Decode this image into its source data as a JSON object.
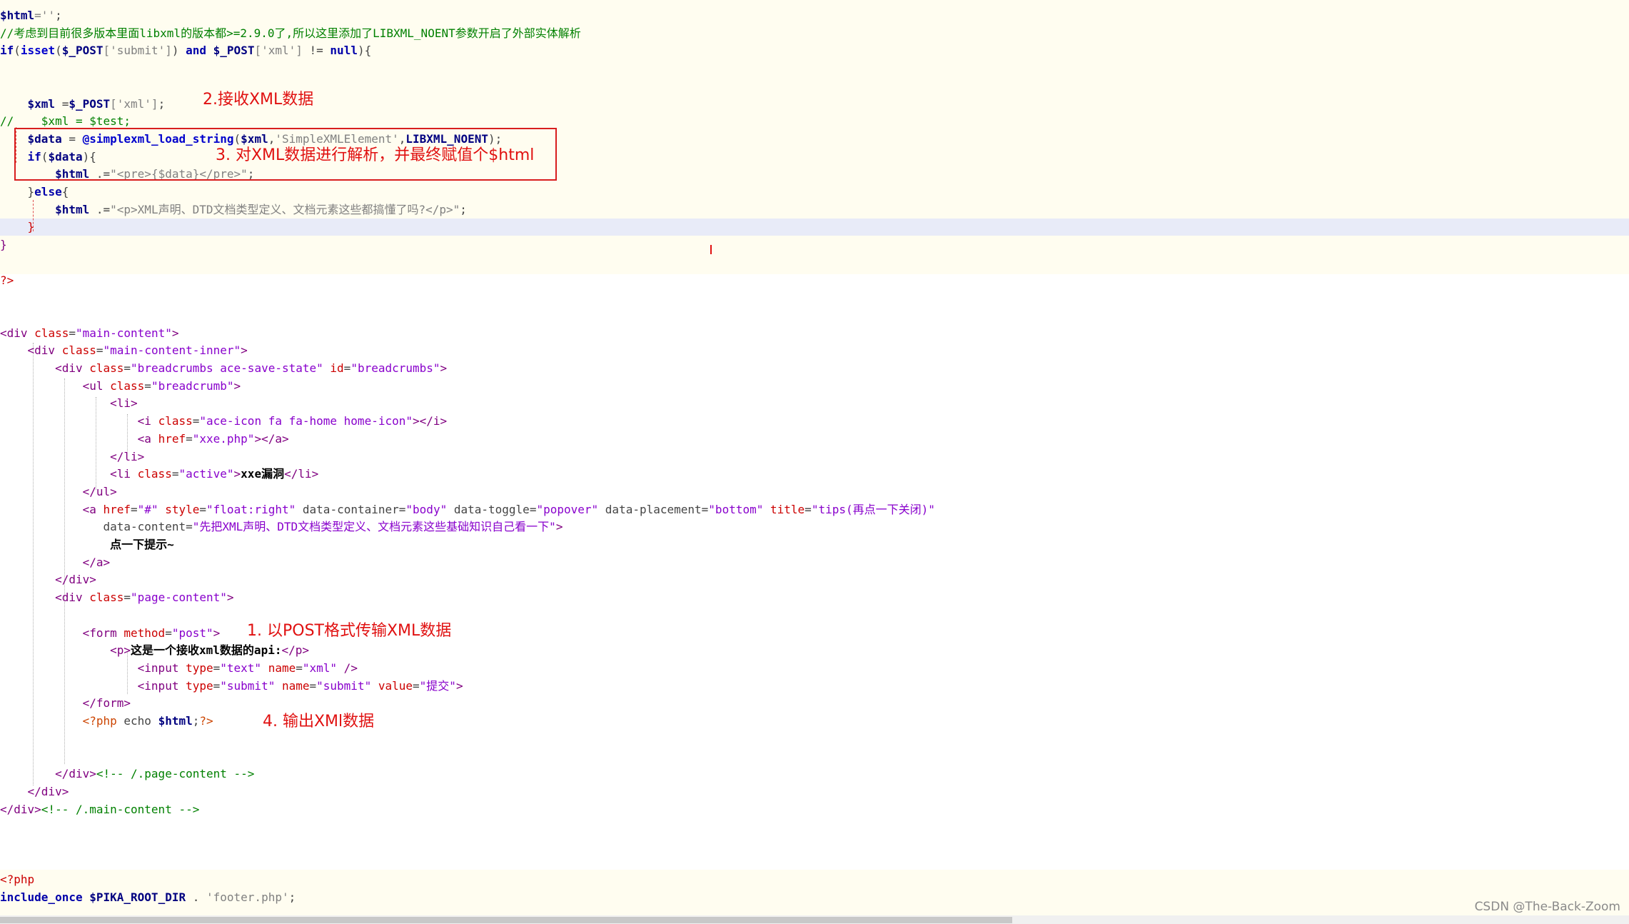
{
  "code": {
    "lines": [
      [
        {
          "t": "$html",
          "c": "v"
        },
        {
          "t": "=''",
          "c": "s"
        },
        {
          "t": ";",
          "c": "d"
        }
      ],
      [
        {
          "t": "//考虑到目前很多版本里面libxml的版本都>=2.9.0了,所以这里添加了LIBXML_NOENT参数开启了外部实体解析",
          "c": "c"
        }
      ],
      [
        {
          "t": "if",
          "c": "k"
        },
        {
          "t": "(",
          "c": "d"
        },
        {
          "t": "isset",
          "c": "f"
        },
        {
          "t": "(",
          "c": "d"
        },
        {
          "t": "$_POST",
          "c": "v"
        },
        {
          "t": "['submit']",
          "c": "s"
        },
        {
          "t": ") ",
          "c": "d"
        },
        {
          "t": "and",
          "c": "k"
        },
        {
          "t": " ",
          "c": "d"
        },
        {
          "t": "$_POST",
          "c": "v"
        },
        {
          "t": "['xml']",
          "c": "s"
        },
        {
          "t": " != ",
          "c": "d"
        },
        {
          "t": "null",
          "c": "k"
        },
        {
          "t": "){",
          "c": "d"
        }
      ],
      [],
      [],
      [
        {
          "t": "    ",
          "c": "d"
        },
        {
          "t": "$xml",
          "c": "v"
        },
        {
          "t": " =",
          "c": "d"
        },
        {
          "t": "$_POST",
          "c": "v"
        },
        {
          "t": "['xml']",
          "c": "s"
        },
        {
          "t": ";",
          "c": "d"
        }
      ],
      [
        {
          "t": "//    $xml = $test;",
          "c": "c"
        }
      ],
      [
        {
          "t": "    ",
          "c": "d"
        },
        {
          "t": "$data",
          "c": "v"
        },
        {
          "t": " = ",
          "c": "d"
        },
        {
          "t": "@simplexml_load_string",
          "c": "f"
        },
        {
          "t": "(",
          "c": "d"
        },
        {
          "t": "$xml",
          "c": "v"
        },
        {
          "t": ",",
          "c": "d"
        },
        {
          "t": "'SimpleXMLElement'",
          "c": "s"
        },
        {
          "t": ",",
          "c": "d"
        },
        {
          "t": "LIBXML_NOENT",
          "c": "v"
        },
        {
          "t": ");",
          "c": "d"
        }
      ],
      [
        {
          "t": "    ",
          "c": "d"
        },
        {
          "t": "if",
          "c": "k"
        },
        {
          "t": "(",
          "c": "d"
        },
        {
          "t": "$data",
          "c": "v"
        },
        {
          "t": "){",
          "c": "d"
        }
      ],
      [
        {
          "t": "        ",
          "c": "d"
        },
        {
          "t": "$html",
          "c": "v"
        },
        {
          "t": " .=",
          "c": "d"
        },
        {
          "t": "\"<pre>{$data}</pre>\"",
          "c": "s"
        },
        {
          "t": ";",
          "c": "d"
        }
      ],
      [
        {
          "t": "    }",
          "c": "d"
        },
        {
          "t": "else",
          "c": "k"
        },
        {
          "t": "{",
          "c": "d"
        }
      ],
      [
        {
          "t": "        ",
          "c": "d"
        },
        {
          "t": "$html",
          "c": "v"
        },
        {
          "t": " .=",
          "c": "d"
        },
        {
          "t": "\"<p>XML声明、DTD文档类型定义、文档元素这些都搞懂了吗?</p>\"",
          "c": "s"
        },
        {
          "t": ";",
          "c": "d"
        }
      ],
      [
        {
          "t": "    }",
          "c": "a"
        }
      ],
      [
        {
          "t": "}",
          "c": "t"
        }
      ],
      [],
      [
        {
          "t": "?>",
          "c": "a"
        }
      ],
      [],
      [],
      [
        {
          "t": "<div ",
          "c": "t"
        },
        {
          "t": "class",
          "c": "a"
        },
        {
          "t": "=",
          "c": "d"
        },
        {
          "t": "\"main-content\"",
          "c": "av"
        },
        {
          "t": ">",
          "c": "t"
        }
      ],
      [
        {
          "t": "    ",
          "c": "d"
        },
        {
          "t": "<div ",
          "c": "t"
        },
        {
          "t": "class",
          "c": "a"
        },
        {
          "t": "=",
          "c": "d"
        },
        {
          "t": "\"main-content-inner\"",
          "c": "av"
        },
        {
          "t": ">",
          "c": "t"
        }
      ],
      [
        {
          "t": "        ",
          "c": "d"
        },
        {
          "t": "<div ",
          "c": "t"
        },
        {
          "t": "class",
          "c": "a"
        },
        {
          "t": "=",
          "c": "d"
        },
        {
          "t": "\"breadcrumbs ace-save-state\"",
          "c": "av"
        },
        {
          "t": " ",
          "c": "d"
        },
        {
          "t": "id",
          "c": "a"
        },
        {
          "t": "=",
          "c": "d"
        },
        {
          "t": "\"breadcrumbs\"",
          "c": "av"
        },
        {
          "t": ">",
          "c": "t"
        }
      ],
      [
        {
          "t": "            ",
          "c": "d"
        },
        {
          "t": "<ul ",
          "c": "t"
        },
        {
          "t": "class",
          "c": "a"
        },
        {
          "t": "=",
          "c": "d"
        },
        {
          "t": "\"breadcrumb\"",
          "c": "av"
        },
        {
          "t": ">",
          "c": "t"
        }
      ],
      [
        {
          "t": "                ",
          "c": "d"
        },
        {
          "t": "<li>",
          "c": "t"
        }
      ],
      [
        {
          "t": "                    ",
          "c": "d"
        },
        {
          "t": "<i ",
          "c": "t"
        },
        {
          "t": "class",
          "c": "a"
        },
        {
          "t": "=",
          "c": "d"
        },
        {
          "t": "\"ace-icon fa fa-home home-icon\"",
          "c": "av"
        },
        {
          "t": "></i>",
          "c": "t"
        }
      ],
      [
        {
          "t": "                    ",
          "c": "d"
        },
        {
          "t": "<a ",
          "c": "t"
        },
        {
          "t": "href",
          "c": "a"
        },
        {
          "t": "=",
          "c": "d"
        },
        {
          "t": "\"xxe.php\"",
          "c": "av"
        },
        {
          "t": "></a>",
          "c": "t"
        }
      ],
      [
        {
          "t": "                ",
          "c": "d"
        },
        {
          "t": "</li>",
          "c": "t"
        }
      ],
      [
        {
          "t": "                ",
          "c": "d"
        },
        {
          "t": "<li ",
          "c": "t"
        },
        {
          "t": "class",
          "c": "a"
        },
        {
          "t": "=",
          "c": "d"
        },
        {
          "t": "\"active\"",
          "c": "av"
        },
        {
          "t": ">",
          "c": "t"
        },
        {
          "t": "xxe漏洞",
          "c": "b"
        },
        {
          "t": "</li>",
          "c": "t"
        }
      ],
      [
        {
          "t": "            ",
          "c": "d"
        },
        {
          "t": "</ul>",
          "c": "t"
        }
      ],
      [
        {
          "t": "            ",
          "c": "d"
        },
        {
          "t": "<a ",
          "c": "t"
        },
        {
          "t": "href",
          "c": "a"
        },
        {
          "t": "=",
          "c": "d"
        },
        {
          "t": "\"#\"",
          "c": "av"
        },
        {
          "t": " ",
          "c": "d"
        },
        {
          "t": "style",
          "c": "a"
        },
        {
          "t": "=",
          "c": "d"
        },
        {
          "t": "\"float:right\"",
          "c": "av"
        },
        {
          "t": " ",
          "c": "d"
        },
        {
          "t": "data-container",
          "c": "d"
        },
        {
          "t": "=",
          "c": "d"
        },
        {
          "t": "\"body\"",
          "c": "av"
        },
        {
          "t": " ",
          "c": "d"
        },
        {
          "t": "data-toggle",
          "c": "d"
        },
        {
          "t": "=",
          "c": "d"
        },
        {
          "t": "\"popover\"",
          "c": "av"
        },
        {
          "t": " ",
          "c": "d"
        },
        {
          "t": "data-placement",
          "c": "d"
        },
        {
          "t": "=",
          "c": "d"
        },
        {
          "t": "\"bottom\"",
          "c": "av"
        },
        {
          "t": " ",
          "c": "d"
        },
        {
          "t": "title",
          "c": "a"
        },
        {
          "t": "=",
          "c": "d"
        },
        {
          "t": "\"tips(再点一下关闭)\"",
          "c": "av"
        }
      ],
      [
        {
          "t": "               ",
          "c": "d"
        },
        {
          "t": "data-content",
          "c": "d"
        },
        {
          "t": "=",
          "c": "d"
        },
        {
          "t": "\"先把XML声明、DTD文档类型定义、文档元素这些基础知识自己看一下\"",
          "c": "av"
        },
        {
          "t": ">",
          "c": "t"
        }
      ],
      [
        {
          "t": "                ",
          "c": "d"
        },
        {
          "t": "点一下提示~",
          "c": "b"
        }
      ],
      [
        {
          "t": "            ",
          "c": "d"
        },
        {
          "t": "</a>",
          "c": "t"
        }
      ],
      [
        {
          "t": "        ",
          "c": "d"
        },
        {
          "t": "</div>",
          "c": "t"
        }
      ],
      [
        {
          "t": "        ",
          "c": "d"
        },
        {
          "t": "<div ",
          "c": "t"
        },
        {
          "t": "class",
          "c": "a"
        },
        {
          "t": "=",
          "c": "d"
        },
        {
          "t": "\"page-content\"",
          "c": "av"
        },
        {
          "t": ">",
          "c": "t"
        }
      ],
      [],
      [
        {
          "t": "            ",
          "c": "d"
        },
        {
          "t": "<form ",
          "c": "t"
        },
        {
          "t": "method",
          "c": "a"
        },
        {
          "t": "=",
          "c": "d"
        },
        {
          "t": "\"post\"",
          "c": "av"
        },
        {
          "t": ">",
          "c": "t"
        }
      ],
      [
        {
          "t": "                ",
          "c": "d"
        },
        {
          "t": "<p>",
          "c": "t"
        },
        {
          "t": "这是一个接收xml数据的api:",
          "c": "b"
        },
        {
          "t": "</p>",
          "c": "t"
        }
      ],
      [
        {
          "t": "                    ",
          "c": "d"
        },
        {
          "t": "<input ",
          "c": "t"
        },
        {
          "t": "type",
          "c": "a"
        },
        {
          "t": "=",
          "c": "d"
        },
        {
          "t": "\"text\"",
          "c": "av"
        },
        {
          "t": " ",
          "c": "d"
        },
        {
          "t": "name",
          "c": "a"
        },
        {
          "t": "=",
          "c": "d"
        },
        {
          "t": "\"xml\"",
          "c": "av"
        },
        {
          "t": " />",
          "c": "t"
        }
      ],
      [
        {
          "t": "                    ",
          "c": "d"
        },
        {
          "t": "<input ",
          "c": "t"
        },
        {
          "t": "type",
          "c": "a"
        },
        {
          "t": "=",
          "c": "d"
        },
        {
          "t": "\"submit\"",
          "c": "av"
        },
        {
          "t": " ",
          "c": "d"
        },
        {
          "t": "name",
          "c": "a"
        },
        {
          "t": "=",
          "c": "d"
        },
        {
          "t": "\"submit\"",
          "c": "av"
        },
        {
          "t": " ",
          "c": "d"
        },
        {
          "t": "value",
          "c": "a"
        },
        {
          "t": "=",
          "c": "d"
        },
        {
          "t": "\"提交\"",
          "c": "av"
        },
        {
          "t": ">",
          "c": "t"
        }
      ],
      [
        {
          "t": "            ",
          "c": "d"
        },
        {
          "t": "</form>",
          "c": "t"
        }
      ],
      [
        {
          "t": "            ",
          "c": "d"
        },
        {
          "t": "<?php",
          "c": "h"
        },
        {
          "t": " echo ",
          "c": "d"
        },
        {
          "t": "$html",
          "c": "v"
        },
        {
          "t": ";",
          "c": "d"
        },
        {
          "t": "?>",
          "c": "h"
        }
      ],
      [],
      [],
      [
        {
          "t": "        ",
          "c": "d"
        },
        {
          "t": "</div>",
          "c": "t"
        },
        {
          "t": "<!-- /.page-content -->",
          "c": "c"
        }
      ],
      [
        {
          "t": "    ",
          "c": "d"
        },
        {
          "t": "</div>",
          "c": "t"
        }
      ],
      [
        {
          "t": "</div>",
          "c": "t"
        },
        {
          "t": "<!-- /.main-content -->",
          "c": "c"
        }
      ],
      [],
      [],
      [],
      [
        {
          "t": "<?php",
          "c": "a"
        }
      ],
      [
        {
          "t": "include_once",
          "c": "k"
        },
        {
          "t": " ",
          "c": "d"
        },
        {
          "t": "$PIKA_ROOT_DIR",
          "c": "v"
        },
        {
          "t": " . ",
          "c": "d"
        },
        {
          "t": "'footer.php'",
          "c": "s"
        },
        {
          "t": ";",
          "c": "d"
        }
      ]
    ]
  },
  "annotations": {
    "a2": "2.接收XML数据",
    "a3": "3. 对XML数据进行解析，并最终赋值个$html",
    "a1": "1. 以POST格式传输XML数据",
    "a4": "4. 输出XMl数据"
  },
  "watermark": "CSDN @The-Back-Zoom",
  "colors": {
    "php_bg": "#fffdf0",
    "current_line": "#e8ebf8",
    "annotation": "#e01010"
  }
}
